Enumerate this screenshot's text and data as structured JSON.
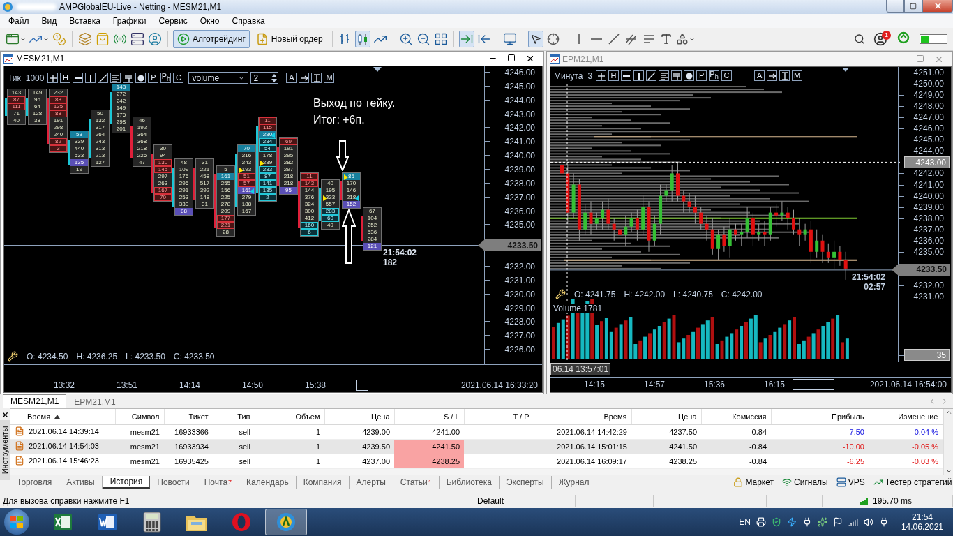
{
  "window": {
    "title": "AMPGlobalEU-Live - Netting - MESM21,M1"
  },
  "menu": [
    "Файл",
    "Вид",
    "Вставка",
    "Графики",
    "Сервис",
    "Окно",
    "Справка"
  ],
  "toolbar": {
    "algo_button": "Алготрейдинг",
    "algo_pressed": true,
    "order_button": "Новый ордер",
    "notification_count": "1"
  },
  "charts": [
    {
      "title": "MESM21,M1",
      "active": true,
      "period_label": "Тик",
      "period_value": "1000",
      "select": "volume",
      "spin": "2",
      "tools": [
        {
          "kind": "cross"
        },
        {
          "kind": "letter",
          "label": "H"
        },
        {
          "kind": "hline"
        },
        {
          "kind": "vline"
        },
        {
          "kind": "trend"
        },
        {
          "kind": "lines"
        },
        {
          "kind": "linesf"
        },
        {
          "kind": "dot"
        },
        {
          "kind": "letter",
          "label": "P"
        },
        {
          "kind": "letter",
          "label": "P$_{h}$"
        },
        {
          "kind": "letter",
          "label": "C"
        }
      ],
      "tools_right": [
        {
          "kind": "letter",
          "label": "A"
        },
        {
          "kind": "arrow"
        },
        {
          "kind": "ibeam"
        },
        {
          "kind": "letter",
          "label": "M"
        }
      ],
      "clusters": [
        {
          "rising": true,
          "cells": [
            {
              "value": "143",
              "kind": "plain"
            },
            {
              "value": "87",
              "kind": "red"
            },
            {
              "value": "111",
              "kind": "red"
            },
            {
              "value": "71",
              "kind": "plain"
            },
            {
              "value": "40",
              "kind": "plain"
            }
          ]
        },
        {
          "rising": true,
          "cells": [
            {
              "value": "149",
              "kind": "plain"
            },
            {
              "value": "96",
              "kind": "plain"
            },
            {
              "value": "64",
              "kind": "plain"
            },
            {
              "value": "128",
              "kind": "plain"
            },
            {
              "value": "38",
              "kind": "plain"
            }
          ]
        },
        {
          "rising": false,
          "cells": [
            {
              "value": "232",
              "kind": "plain"
            },
            {
              "value": "88",
              "kind": "red"
            },
            {
              "value": "135",
              "kind": "red"
            },
            {
              "value": "88",
              "kind": "red"
            },
            {
              "value": "191",
              "kind": "plain"
            },
            {
              "value": "298",
              "kind": "plain"
            },
            {
              "value": "240",
              "kind": "plain"
            },
            {
              "value": "82",
              "kind": "red"
            },
            {
              "value": "3",
              "kind": "red"
            }
          ]
        },
        {
          "rising": true,
          "cells": [
            {
              "value": "53",
              "kind": "teal"
            },
            {
              "value": "339",
              "kind": "plain"
            },
            {
              "value": "440",
              "kind": "plain"
            },
            {
              "value": "533",
              "kind": "plain"
            },
            {
              "value": "135",
              "kind": "purple"
            },
            {
              "value": "19",
              "kind": "plain"
            }
          ]
        },
        {
          "rising": true,
          "cells": [
            {
              "value": "50",
              "kind": "plain"
            },
            {
              "value": "132",
              "kind": "plain"
            },
            {
              "value": "317",
              "kind": "plain"
            },
            {
              "value": "264",
              "kind": "plain"
            },
            {
              "value": "243",
              "kind": "plain"
            },
            {
              "value": "313",
              "kind": "plain"
            },
            {
              "value": "213",
              "kind": "plain"
            },
            {
              "value": "127",
              "kind": "plain"
            }
          ]
        },
        {
          "rising": true,
          "cells": [
            {
              "value": "148",
              "kind": "teal"
            },
            {
              "value": "272",
              "kind": "plain"
            },
            {
              "value": "242",
              "kind": "plain"
            },
            {
              "value": "149",
              "kind": "plain"
            },
            {
              "value": "176",
              "kind": "plain"
            },
            {
              "value": "298",
              "kind": "plain"
            },
            {
              "value": "201",
              "kind": "plain"
            }
          ]
        },
        {
          "rising": false,
          "cells": [
            {
              "value": "46",
              "kind": "plain"
            },
            {
              "value": "192",
              "kind": "plain"
            },
            {
              "value": "364",
              "kind": "plain"
            },
            {
              "value": "368",
              "kind": "plain"
            },
            {
              "value": "218",
              "kind": "plain"
            },
            {
              "value": "226",
              "kind": "plain"
            },
            {
              "value": "47",
              "kind": "plain"
            }
          ]
        },
        {
          "rising": false,
          "cells": [
            {
              "value": "30",
              "kind": "plain"
            },
            {
              "value": "94",
              "kind": "plain"
            },
            {
              "value": "130",
              "kind": "red"
            },
            {
              "value": "145",
              "kind": "red"
            },
            {
              "value": "297",
              "kind": "plain"
            },
            {
              "value": "263",
              "kind": "plain"
            },
            {
              "value": "167",
              "kind": "red"
            },
            {
              "value": "70",
              "kind": "red"
            }
          ]
        },
        {
          "rising": true,
          "cells": [
            {
              "value": "48",
              "kind": "plain"
            },
            {
              "value": "109",
              "kind": "plain"
            },
            {
              "value": "176",
              "kind": "plain"
            },
            {
              "value": "296",
              "kind": "plain"
            },
            {
              "value": "291",
              "kind": "plain"
            },
            {
              "value": "253",
              "kind": "plain"
            },
            {
              "value": "330",
              "kind": "plain"
            },
            {
              "value": "88",
              "kind": "purple"
            }
          ]
        },
        {
          "rising": false,
          "cells": [
            {
              "value": "31",
              "kind": "plain"
            },
            {
              "value": "221",
              "kind": "plain"
            },
            {
              "value": "458",
              "kind": "plain"
            },
            {
              "value": "517",
              "kind": "plain"
            },
            {
              "value": "392",
              "kind": "plain"
            },
            {
              "value": "148",
              "kind": "plain"
            },
            {
              "value": "31",
              "kind": "plain"
            }
          ]
        },
        {
          "rising": false,
          "cells": [
            {
              "value": "5",
              "kind": "plain"
            },
            {
              "value": "161",
              "kind": "teal"
            },
            {
              "value": "255",
              "kind": "plain"
            },
            {
              "value": "156",
              "kind": "plain"
            },
            {
              "value": "225",
              "kind": "plain"
            },
            {
              "value": "278",
              "kind": "plain"
            },
            {
              "value": "209",
              "kind": "plain"
            },
            {
              "value": "177",
              "kind": "red"
            },
            {
              "value": "221",
              "kind": "red"
            },
            {
              "value": "28",
              "kind": "plain"
            }
          ]
        },
        {
          "rising": true,
          "cells": [
            {
              "value": "70",
              "kind": "teal"
            },
            {
              "value": "216",
              "kind": "plain"
            },
            {
              "value": "243",
              "kind": "plain"
            },
            {
              "value": "193",
              "kind": "plain",
              "buy_arrow": true
            },
            {
              "value": "51",
              "kind": "red"
            },
            {
              "value": "57",
              "kind": "red"
            },
            {
              "value": "161",
              "kind": "purple",
              "sell_arrow": true
            },
            {
              "value": "279",
              "kind": "plain"
            },
            {
              "value": "188",
              "kind": "plain"
            },
            {
              "value": "167",
              "kind": "plain"
            }
          ]
        },
        {
          "rising": true,
          "cells": [
            {
              "value": "11",
              "kind": "red"
            },
            {
              "value": "115",
              "kind": "red"
            },
            {
              "value": "280",
              "kind": "teal",
              "sell_arrow": true
            },
            {
              "value": "234",
              "kind": "cyan"
            },
            {
              "value": "54",
              "kind": "cyan"
            },
            {
              "value": "178",
              "kind": "plain"
            },
            {
              "value": "239",
              "kind": "plain",
              "buy_arrow": true
            },
            {
              "value": "233",
              "kind": "cyan"
            },
            {
              "value": "87",
              "kind": "cyan"
            },
            {
              "value": "141",
              "kind": "cyan"
            },
            {
              "value": "135",
              "kind": "cyan"
            },
            {
              "value": "2",
              "kind": "cyan"
            }
          ]
        },
        {
          "rising": false,
          "cells": [
            {
              "value": "69",
              "kind": "red"
            },
            {
              "value": "191",
              "kind": "plain"
            },
            {
              "value": "295",
              "kind": "plain"
            },
            {
              "value": "282",
              "kind": "plain"
            },
            {
              "value": "297",
              "kind": "plain"
            },
            {
              "value": "218",
              "kind": "plain"
            },
            {
              "value": "218",
              "kind": "plain"
            },
            {
              "value": "95",
              "kind": "purple"
            }
          ]
        },
        {
          "rising": false,
          "cells": [
            {
              "value": "11",
              "kind": "red"
            },
            {
              "value": "143",
              "kind": "red"
            },
            {
              "value": "144",
              "kind": "plain"
            },
            {
              "value": "376",
              "kind": "plain"
            },
            {
              "value": "324",
              "kind": "plain"
            },
            {
              "value": "300",
              "kind": "plain"
            },
            {
              "value": "412",
              "kind": "plain"
            },
            {
              "value": "160",
              "kind": "cyan"
            },
            {
              "value": "6",
              "kind": "cyan"
            }
          ]
        },
        {
          "rising": true,
          "cells": [
            {
              "value": "40",
              "kind": "plain"
            },
            {
              "value": "195",
              "kind": "plain"
            },
            {
              "value": "333",
              "kind": "plain",
              "buy_arrow": true
            },
            {
              "value": "557",
              "kind": "plain"
            },
            {
              "value": "283",
              "kind": "cyan"
            },
            {
              "value": "60",
              "kind": "cyan"
            },
            {
              "value": "49",
              "kind": "plain"
            }
          ]
        },
        {
          "rising": false,
          "cells": [
            {
              "value": "85",
              "kind": "teal",
              "buy_arrow": true
            },
            {
              "value": "170",
              "kind": "plain"
            },
            {
              "value": "146",
              "kind": "plain"
            },
            {
              "value": "218",
              "kind": "plain",
              "sell_arrow": true
            },
            {
              "value": "152",
              "kind": "purple"
            }
          ]
        },
        {
          "rising": false,
          "cells": [
            {
              "value": "67",
              "kind": "plain"
            },
            {
              "value": "104",
              "kind": "plain"
            },
            {
              "value": "252",
              "kind": "plain"
            },
            {
              "value": "536",
              "kind": "plain"
            },
            {
              "value": "284",
              "kind": "plain"
            },
            {
              "value": "121",
              "kind": "purple"
            }
          ]
        }
      ],
      "note": [
        "Выход по тейку.",
        "Итог: +6п."
      ],
      "last_time": "21:54:02",
      "last_value": "182",
      "ohlc": [
        "O: 4234.50",
        "H: 4236.25",
        "L: 4233.50",
        "C: 4233.50"
      ],
      "price_axis_upper": [
        "4246.00",
        "4245.00",
        "4244.00",
        "4243.00",
        "4242.00",
        "4241.00",
        "4240.00",
        "4239.00",
        "4238.00",
        "4237.00",
        "4236.00",
        "4235.00"
      ],
      "price_axis_lower": [
        "4232.00",
        "4231.00",
        "4230.00",
        "4229.00",
        "4228.00",
        "4227.00",
        "4226.00"
      ],
      "price_tag": "4233.50",
      "time_axis": [
        "13:32",
        "13:51",
        "14:14",
        "14:50",
        "15:38"
      ],
      "end_time": "2021.06.14 16:33:20"
    },
    {
      "title": "EPM21,M1",
      "active": false,
      "period_label": "Минута",
      "period_value": "3",
      "tools": [
        {
          "kind": "cross"
        },
        {
          "kind": "letter",
          "label": "H"
        },
        {
          "kind": "hline"
        },
        {
          "kind": "vline"
        },
        {
          "kind": "trend"
        },
        {
          "kind": "lines"
        },
        {
          "kind": "linesf"
        },
        {
          "kind": "dot"
        },
        {
          "kind": "letter",
          "label": "P"
        },
        {
          "kind": "letter",
          "label": "P$_{h}$"
        },
        {
          "kind": "letter",
          "label": "C"
        }
      ],
      "tools_right": [
        {
          "kind": "letter",
          "label": "A"
        },
        {
          "kind": "arrow"
        },
        {
          "kind": "ibeam"
        },
        {
          "kind": "letter",
          "label": "M"
        }
      ],
      "price_axis_upper": [
        "4251.00",
        "4250.00",
        "4249.00",
        "4248.00",
        "4247.00",
        "4246.00",
        "4245.00",
        "4244.00"
      ],
      "price_axis_middle": [
        "4242.00",
        "4241.00",
        "4240.00",
        "4239.00",
        "4238.00",
        "4237.00",
        "4236.00",
        "4235.00"
      ],
      "price_axis_lower": [
        "4232.00",
        "4231.00"
      ],
      "crosshair_tag": "4243.00",
      "price_tag": "4233.50",
      "last_time": "21:54:02",
      "countdown": "02:57",
      "ohlc": [
        "O: 4241.75",
        "H: 4242.00",
        "L: 4240.75",
        "C: 4242.00"
      ],
      "volume_label": "Volume 1781",
      "volume_tag": "35",
      "crosshair_time": "06.14 13:57:01",
      "time_axis": [
        "14:15",
        "14:57",
        "15:36",
        "16:15"
      ],
      "end_time": "2021.06.14 16:54:00"
    }
  ],
  "chart_tabs": [
    {
      "label": "MESM21,M1",
      "selected": true
    },
    {
      "label": "EPM21,M1",
      "selected": false
    }
  ],
  "side_label": "Инструменты",
  "trade_table": {
    "columns": [
      "Время",
      "Символ",
      "Тикет",
      "Тип",
      "Объем",
      "Цена",
      "S / L",
      "T / P",
      "Время",
      "Цена",
      "Комиссия",
      "Прибыль",
      "Изменение"
    ],
    "rows": [
      {
        "open_time": "2021.06.14 14:39:14",
        "symbol": "mesm21",
        "ticket": "16933366",
        "type": "sell",
        "volume": "1",
        "price": "4239.00",
        "sl": "4241.00",
        "close_time": "2021.06.14 14:42:29",
        "close_price": "4237.50",
        "commission": "-0.84",
        "profit": "7.50",
        "change": "0.04 %",
        "profitable": true,
        "sl_hit": false,
        "selected": false
      },
      {
        "open_time": "2021.06.14 14:54:03",
        "symbol": "mesm21",
        "ticket": "16933934",
        "type": "sell",
        "volume": "1",
        "price": "4239.50",
        "sl": "4241.50",
        "close_time": "2021.06.14 15:01:15",
        "close_price": "4241.50",
        "commission": "-0.84",
        "profit": "-10.00",
        "change": "-0.05 %",
        "profitable": false,
        "sl_hit": true,
        "selected": true
      },
      {
        "open_time": "2021.06.14 15:46:23",
        "symbol": "mesm21",
        "ticket": "16935425",
        "type": "sell",
        "volume": "1",
        "price": "4237.00",
        "sl": "4238.25",
        "close_time": "2021.06.14 16:09:17",
        "close_price": "4238.25",
        "commission": "-0.84",
        "profit": "-6.25",
        "change": "-0.03 %",
        "profitable": false,
        "sl_hit": true,
        "selected": false
      }
    ]
  },
  "panel_tabs": [
    {
      "label": "Торговля",
      "selected": false
    },
    {
      "label": "Активы",
      "selected": false
    },
    {
      "label": "История",
      "selected": true
    },
    {
      "label": "Новости",
      "selected": false
    },
    {
      "label": "Почта",
      "badge": "7",
      "selected": false
    },
    {
      "label": "Календарь",
      "selected": false
    },
    {
      "label": "Компания",
      "selected": false
    },
    {
      "label": "Алерты",
      "selected": false
    },
    {
      "label": "Статьи",
      "badge": "1",
      "selected": false
    },
    {
      "label": "Библиотека",
      "selected": false
    },
    {
      "label": "Эксперты",
      "selected": false
    },
    {
      "label": "Журнал",
      "selected": false
    }
  ],
  "panel_links": [
    {
      "label": "Маркет",
      "kind": "market"
    },
    {
      "label": "Сигналы",
      "kind": "signals"
    },
    {
      "label": "VPS",
      "kind": "vps"
    },
    {
      "label": "Тестер стратегий",
      "kind": "tester"
    }
  ],
  "status_bar": {
    "help": "Для вызова справки нажмите F1",
    "profile": "Default",
    "ping": "195.70 ms"
  },
  "taskbar": {
    "apps": [
      {
        "kind": "sheet",
        "active": false
      },
      {
        "kind": "doc",
        "active": false
      },
      {
        "kind": "calc",
        "active": false
      },
      {
        "kind": "folder",
        "active": false
      },
      {
        "kind": "browser",
        "active": false
      },
      {
        "kind": "terminal",
        "active": true
      }
    ],
    "language": "EN",
    "time": "21:54",
    "date": "14.06.2021"
  }
}
